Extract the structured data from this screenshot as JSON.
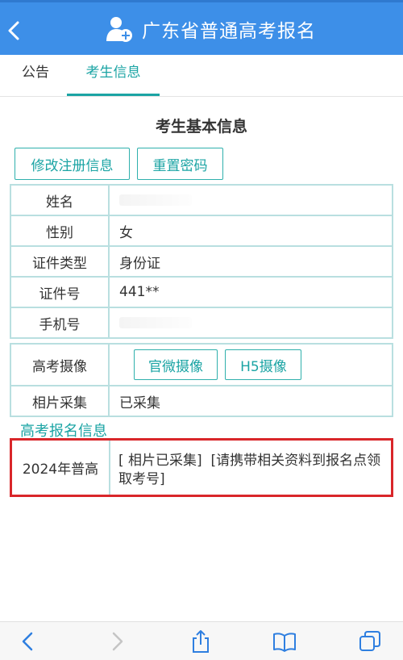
{
  "header": {
    "title": "广东省普通高考报名",
    "back_icon": "chevron-left-icon",
    "title_icon": "person-add-icon",
    "bar_color": "#3d8fe8"
  },
  "tabs": [
    {
      "label": "公告",
      "active": false
    },
    {
      "label": "考生信息",
      "active": true
    }
  ],
  "section": {
    "title": "考生基本信息",
    "edit_button": "修改注册信息",
    "reset_button": "重置密码"
  },
  "basic_info": [
    {
      "label": "姓名",
      "value": ""
    },
    {
      "label": "性别",
      "value": "女"
    },
    {
      "label": "证件类型",
      "value": "身份证"
    },
    {
      "label": "证件号",
      "value": "441**"
    },
    {
      "label": "手机号",
      "value": ""
    }
  ],
  "photo": {
    "camera_label": "高考摄像",
    "official_button": "官微摄像",
    "h5_button": "H5摄像",
    "collect_label": "相片采集",
    "collect_value": "已采集"
  },
  "registration": {
    "heading": "高考报名信息",
    "year_label": "2024年普高",
    "status_part1": "[ 相片已采集]",
    "status_part2": "[请携带相关资料到报名点领取考号]",
    "highlight_color": "#d9262a"
  },
  "colors": {
    "accent": "#1ba4a4",
    "border": "#b9dfe0"
  },
  "toolbar": {
    "icons": [
      "back-icon",
      "forward-icon",
      "share-icon",
      "bookmarks-icon",
      "tabs-icon"
    ]
  }
}
